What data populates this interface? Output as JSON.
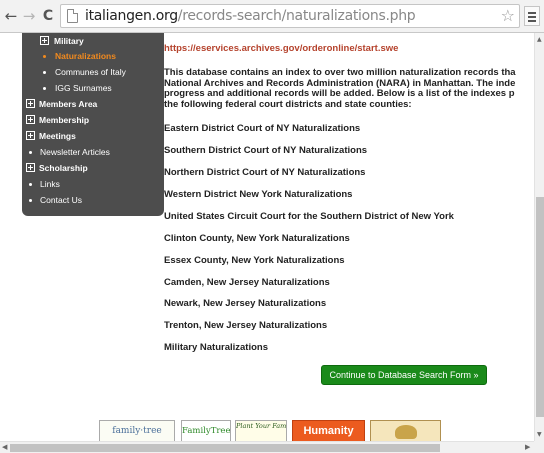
{
  "browser": {
    "url_host": "italiangen.org",
    "url_path": "/records-search/naturalizations.php",
    "back_icon": "←",
    "forward_icon": "→",
    "reload_icon": "C",
    "star_icon": "☆"
  },
  "sidebar": {
    "items": [
      {
        "label": "Military",
        "type": "expander",
        "level": 1
      },
      {
        "label": "Naturalizations",
        "type": "bullet",
        "level": 2,
        "active": true
      },
      {
        "label": "Communes of Italy",
        "type": "bullet",
        "level": 2
      },
      {
        "label": "IGG Surnames",
        "type": "bullet",
        "level": 2
      },
      {
        "label": "Members Area",
        "type": "expander",
        "level": 0
      },
      {
        "label": "Membership",
        "type": "expander",
        "level": 0
      },
      {
        "label": "Meetings",
        "type": "expander",
        "level": 0
      },
      {
        "label": "Newsletter Articles",
        "type": "bullet",
        "level": 0
      },
      {
        "label": "Scholarship",
        "type": "expander",
        "level": 0
      },
      {
        "label": "Links",
        "type": "bullet",
        "level": 0
      },
      {
        "label": "Contact Us",
        "type": "bullet",
        "level": 0
      }
    ]
  },
  "main": {
    "order_link": "https://eservices.archives.gov/orderonline/start.swe",
    "intro_lines": [
      "This database contains an index to over two million naturalization records tha",
      "National Archives and Records Administration (NARA) in Manhattan. The inde",
      "progress and additional records will be added. Below is a list of the indexes p",
      "the following federal court districts and state counties:"
    ],
    "courts": [
      "Eastern District Court of NY Naturalizations",
      "Southern District Court of NY Naturalizations",
      "Northern District Court of NY Naturalizations",
      "Western District New York Naturalizations",
      "United States Circuit Court for the Southern District of New York",
      "Clinton County, New York Naturalizations",
      "Essex County, New York Naturalizations",
      "Camden, New Jersey Naturalizations",
      "Newark,  New Jersey Naturalizations",
      "Trenton, New Jersey Naturalizations",
      "Military Naturalizations"
    ],
    "cta_label": "Continue to Database Search Form »"
  },
  "banners": [
    {
      "label": "family·tree"
    },
    {
      "label": "FamilyTree"
    },
    {
      "label": "Plant Your Family Tree"
    },
    {
      "label": "Humanity"
    },
    {
      "label": ""
    }
  ],
  "colors": {
    "sidebar_bg": "#4d4d4d",
    "active_link": "#f28a1e",
    "order_link": "#b5432d",
    "cta_bg": "#1a8a1a"
  }
}
